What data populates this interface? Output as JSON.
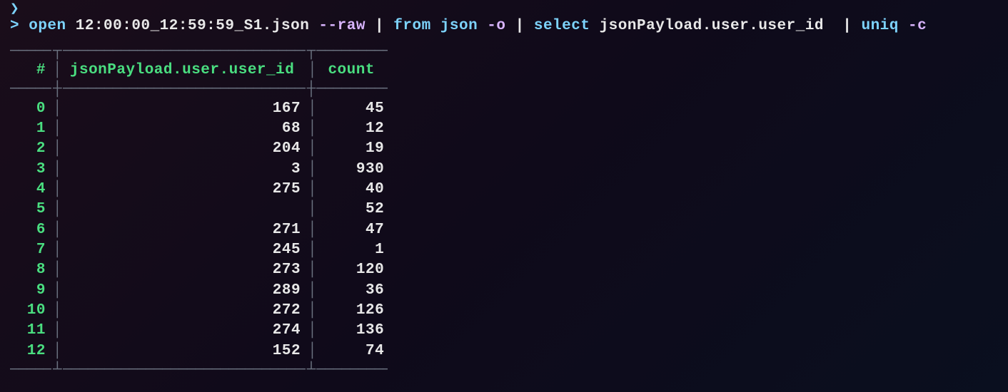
{
  "prompt": {
    "caret": ">",
    "cmd1": "open",
    "file": "12:00:00_12:59:59_S1.json",
    "flag1": "--raw",
    "pipe": "|",
    "cmd2": "from json",
    "flag2": "-o",
    "cmd3": "select",
    "selector": "jsonPayload.user.user_id",
    "cmd4": "uniq",
    "flag4": "-c"
  },
  "table": {
    "headers": {
      "index": "#",
      "userid": "jsonPayload.user.user_id",
      "count": "count"
    },
    "rows": [
      {
        "index": "0",
        "userid": "167",
        "count": "45"
      },
      {
        "index": "1",
        "userid": "68",
        "count": "12"
      },
      {
        "index": "2",
        "userid": "204",
        "count": "19"
      },
      {
        "index": "3",
        "userid": "3",
        "count": "930"
      },
      {
        "index": "4",
        "userid": "275",
        "count": "40"
      },
      {
        "index": "5",
        "userid": "",
        "count": "52"
      },
      {
        "index": "6",
        "userid": "271",
        "count": "47"
      },
      {
        "index": "7",
        "userid": "245",
        "count": "1"
      },
      {
        "index": "8",
        "userid": "273",
        "count": "120"
      },
      {
        "index": "9",
        "userid": "289",
        "count": "36"
      },
      {
        "index": "10",
        "userid": "272",
        "count": "126"
      },
      {
        "index": "11",
        "userid": "274",
        "count": "136"
      },
      {
        "index": "12",
        "userid": "152",
        "count": "74"
      }
    ]
  }
}
